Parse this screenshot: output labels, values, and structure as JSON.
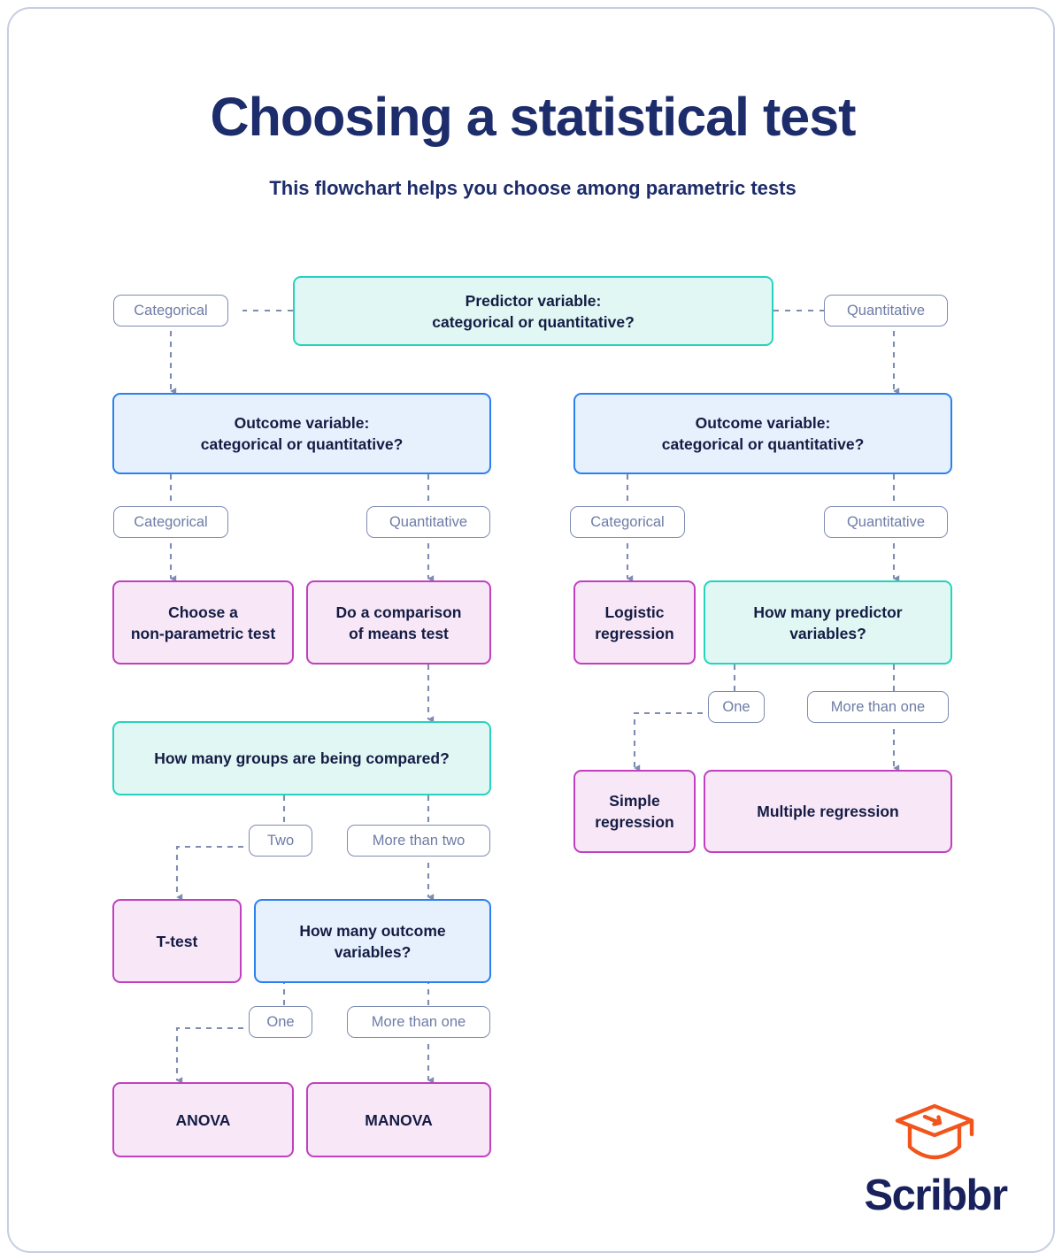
{
  "header": {
    "title": "Choosing a statistical test",
    "subtitle": "This flowchart helps you choose among parametric tests"
  },
  "colors": {
    "title_navy": "#1D2C6B",
    "node_text": "#141C44",
    "teal_border": "#27D3BC",
    "teal_fill": "#E0F7F4",
    "blue_border": "#2B80EF",
    "blue_fill": "#E7F1FD",
    "pink_border": "#C040BF",
    "pink_fill": "#F8E7F7",
    "pill_border": "#7E8CB2",
    "pill_text": "#6E7CA6",
    "connector": "#7E8CB2",
    "card_border": "#C7CDE2",
    "logo_orange": "#F2551C",
    "logo_navy": "#18215C"
  },
  "nodes": {
    "predictor_variable": "Predictor variable:\ncategorical or quantitative?",
    "outcome_variable_left": "Outcome variable:\ncategorical or quantitative?",
    "outcome_variable_right": "Outcome variable:\ncategorical or quantitative?",
    "non_parametric": "Choose a\nnon-parametric test",
    "comparison_of_means": "Do a comparison\nof means test",
    "logistic_regression": "Logistic\nregression",
    "how_many_predictors": "How many predictor\nvariables?",
    "how_many_groups": "How many groups are being compared?",
    "simple_regression": "Simple\nregression",
    "multiple_regression": "Multiple regression",
    "t_test": "T-test",
    "how_many_outcomes": "How many outcome\nvariables?",
    "anova": "ANOVA",
    "manova": "MANOVA"
  },
  "labels": {
    "predictor_categorical": "Categorical",
    "predictor_quantitative": "Quantitative",
    "left_outcome_categorical": "Categorical",
    "left_outcome_quantitative": "Quantitative",
    "right_outcome_categorical": "Categorical",
    "right_outcome_quantitative": "Quantitative",
    "predictors_one": "One",
    "predictors_more_than_one": "More than one",
    "groups_two": "Two",
    "groups_more_than_two": "More than two",
    "outcomes_one": "One",
    "outcomes_more_than_one": "More than one"
  },
  "logo": {
    "wordmark": "Scribbr",
    "icon": "graduation-cap-icon"
  },
  "chart_data": {
    "type": "diagram",
    "title": "Choosing a statistical test",
    "subtitle": "This flowchart helps you choose among parametric tests",
    "node_kinds": {
      "teal": "decision / question (teal)",
      "blue": "decision / question (blue)",
      "pink": "terminal result / test recommendation (pink)",
      "pill": "edge label (answer branch)"
    },
    "steps": [
      {
        "id": "predictor_variable",
        "kind": "teal",
        "text": "Predictor variable: categorical or quantitative?",
        "branches": [
          {
            "label": "Categorical",
            "to": "outcome_variable_left"
          },
          {
            "label": "Quantitative",
            "to": "outcome_variable_right"
          }
        ]
      },
      {
        "id": "outcome_variable_left",
        "kind": "blue",
        "text": "Outcome variable: categorical or quantitative?",
        "branches": [
          {
            "label": "Categorical",
            "to": "non_parametric"
          },
          {
            "label": "Quantitative",
            "to": "comparison_of_means"
          }
        ]
      },
      {
        "id": "non_parametric",
        "kind": "pink",
        "text": "Choose a non-parametric test",
        "branches": []
      },
      {
        "id": "comparison_of_means",
        "kind": "pink",
        "text": "Do a comparison of means test",
        "branches": [
          {
            "label": "",
            "to": "how_many_groups"
          }
        ]
      },
      {
        "id": "how_many_groups",
        "kind": "teal",
        "text": "How many groups are being compared?",
        "branches": [
          {
            "label": "Two",
            "to": "t_test"
          },
          {
            "label": "More than two",
            "to": "how_many_outcomes"
          }
        ]
      },
      {
        "id": "t_test",
        "kind": "pink",
        "text": "T-test",
        "branches": []
      },
      {
        "id": "how_many_outcomes",
        "kind": "blue",
        "text": "How many outcome variables?",
        "branches": [
          {
            "label": "One",
            "to": "anova"
          },
          {
            "label": "More than one",
            "to": "manova"
          }
        ]
      },
      {
        "id": "anova",
        "kind": "pink",
        "text": "ANOVA",
        "branches": []
      },
      {
        "id": "manova",
        "kind": "pink",
        "text": "MANOVA",
        "branches": []
      },
      {
        "id": "outcome_variable_right",
        "kind": "blue",
        "text": "Outcome variable: categorical or quantitative?",
        "branches": [
          {
            "label": "Categorical",
            "to": "logistic_regression"
          },
          {
            "label": "Quantitative",
            "to": "how_many_predictors"
          }
        ]
      },
      {
        "id": "logistic_regression",
        "kind": "pink",
        "text": "Logistic regression",
        "branches": []
      },
      {
        "id": "how_many_predictors",
        "kind": "teal",
        "text": "How many predictor variables?",
        "branches": [
          {
            "label": "One",
            "to": "simple_regression"
          },
          {
            "label": "More than one",
            "to": "multiple_regression"
          }
        ]
      },
      {
        "id": "simple_regression",
        "kind": "pink",
        "text": "Simple regression",
        "branches": []
      },
      {
        "id": "multiple_regression",
        "kind": "pink",
        "text": "Multiple regression",
        "branches": []
      }
    ]
  }
}
